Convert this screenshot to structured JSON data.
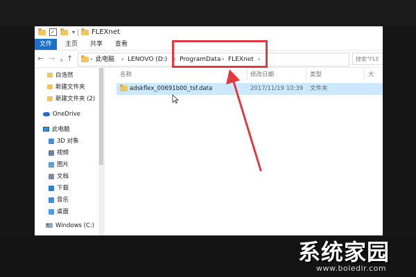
{
  "window": {
    "title": "FLEXnet",
    "quick_access_dropdown": "▾"
  },
  "ribbon": {
    "file_tab": "文件",
    "home_tab": "主页",
    "share_tab": "共享",
    "view_tab": "查看"
  },
  "address_bar": {
    "back": "←",
    "forward": "→",
    "history": "∨",
    "up": "↑",
    "crumbs": [
      "此电脑",
      "LENOVO (D:)",
      "ProgramData",
      "FLEXnet"
    ],
    "separator": "›",
    "search_placeholder": "搜索\"FLE"
  },
  "nav_pane": {
    "quick_access": [
      "白浩然",
      "新建文件夹",
      "新建文件夹 (2)"
    ],
    "onedrive": "OneDrive",
    "this_pc": "此电脑",
    "libraries": [
      {
        "label": "3D 对象",
        "color": "#4a90d9"
      },
      {
        "label": "视频",
        "color": "#6b7fa8"
      },
      {
        "label": "图片",
        "color": "#5aa0d8"
      },
      {
        "label": "文档",
        "color": "#7f8c9a"
      },
      {
        "label": "下载",
        "color": "#2f7fd3"
      },
      {
        "label": "音乐",
        "color": "#3c8de0"
      },
      {
        "label": "桌面",
        "color": "#4aa0e8"
      }
    ],
    "drive": "Windows (C:)"
  },
  "columns": {
    "name": "名称",
    "date": "修改日期",
    "type": "类型",
    "size": "大"
  },
  "files": [
    {
      "name": "adskflex_00691b00_tsf.data",
      "date": "2017/11/19 10:39",
      "type": "文件夹"
    }
  ],
  "watermark": {
    "title": "系统家园",
    "url": "www.boledir.com"
  },
  "colors": {
    "accent": "#1e6fc9",
    "selection": "#cce8ff",
    "annotation": "#e0393e",
    "folder": "#f2c55c"
  }
}
